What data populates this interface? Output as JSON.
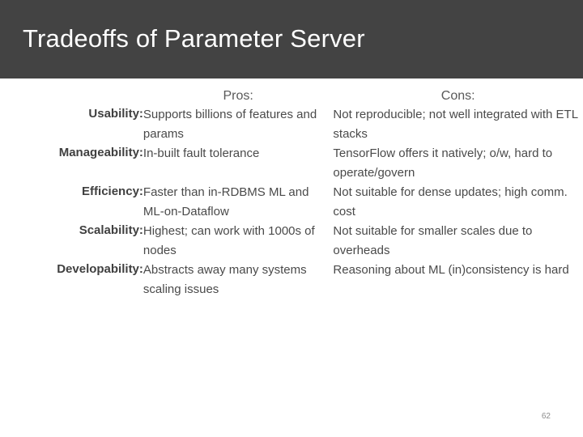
{
  "slide": {
    "title": "Tradeoffs of Parameter Server",
    "page_number": "62",
    "colors": {
      "title_bar_background": "#434343",
      "title_text": "#ffffff",
      "body_text": "#4a4a4a",
      "label_text": "#404040",
      "header_text": "#595959",
      "page_number_text": "#8c8c8c",
      "slide_background": "#ffffff"
    }
  },
  "table": {
    "headers": {
      "label": "",
      "pros": "Pros:",
      "cons": "Cons:"
    },
    "rows": [
      {
        "label": "Usability:",
        "pros": "Supports billions of features and params",
        "cons": "Not reproducible; not well integrated with ETL stacks"
      },
      {
        "label": "Manageability:",
        "pros": "In-built fault tolerance",
        "cons": "TensorFlow offers it natively; o/w, hard to operate/govern"
      },
      {
        "label": "Efficiency:",
        "pros": "Faster than in-RDBMS ML and ML-on-Dataflow",
        "cons": "Not suitable for dense updates; high comm. cost"
      },
      {
        "label": "Scalability:",
        "pros": "Highest; can work with 1000s of nodes",
        "cons": "Not suitable for smaller scales due to overheads"
      },
      {
        "label": "Developability:",
        "pros": "Abstracts away many systems scaling issues",
        "cons": "Reasoning about ML (in)consistency is hard"
      }
    ]
  }
}
